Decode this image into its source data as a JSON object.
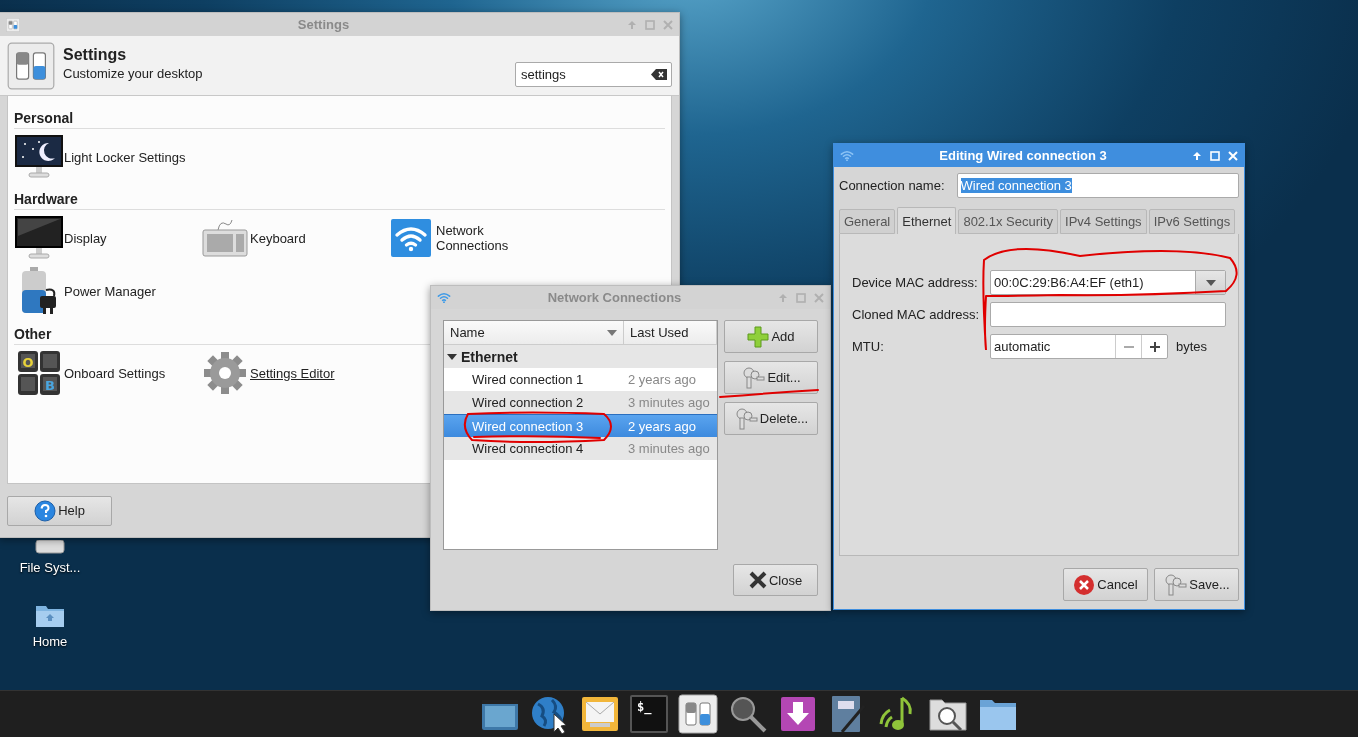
{
  "desktop_icons": [
    {
      "label": "File Syst...",
      "kind": "drive"
    },
    {
      "label": "Home",
      "kind": "folder"
    }
  ],
  "settings_window": {
    "title": "Settings",
    "header_title": "Settings",
    "header_subtitle": "Customize your desktop",
    "search": {
      "value": "settings"
    },
    "sections": [
      {
        "title": "Personal",
        "items": [
          {
            "label": "Light Locker Settings",
            "kind": "lock",
            "hovered": false
          }
        ]
      },
      {
        "title": "Hardware",
        "items": [
          {
            "label": "Display",
            "kind": "display",
            "hovered": false
          },
          {
            "label": "Keyboard",
            "kind": "keyboard",
            "hovered": false
          },
          {
            "label": "Network Connections",
            "kind": "network",
            "hovered": false
          },
          {
            "label": "Power Manager",
            "kind": "power",
            "hovered": false
          }
        ]
      },
      {
        "title": "Other",
        "items": [
          {
            "label": "Onboard Settings",
            "kind": "onboard",
            "glyphs": [
              "O",
              "B"
            ],
            "hovered": false
          },
          {
            "label": "Settings Editor",
            "kind": "editor",
            "hovered": true
          }
        ]
      }
    ],
    "help_button": "Help"
  },
  "network_window": {
    "title": "Network Connections",
    "columns": [
      "Name",
      "Last Used"
    ],
    "groups": [
      {
        "name": "Ethernet",
        "expanded": true,
        "rows": [
          {
            "name": "Wired connection 1",
            "last_used": "2 years ago",
            "selected": false
          },
          {
            "name": "Wired connection 2",
            "last_used": "3 minutes ago",
            "selected": false
          },
          {
            "name": "Wired connection 3",
            "last_used": "2 years ago",
            "selected": true
          },
          {
            "name": "Wired connection 4",
            "last_used": "3 minutes ago",
            "selected": false
          }
        ]
      }
    ],
    "buttons": [
      {
        "label": "Add",
        "kind": "add"
      },
      {
        "label": "Edit...",
        "kind": "edit"
      },
      {
        "label": "Delete...",
        "kind": "delete"
      }
    ],
    "close_button": "Close"
  },
  "edit_window": {
    "title": "Editing Wired connection 3",
    "connection_name": {
      "label": "Connection name:",
      "value": "Wired connection 3",
      "text_selected": true
    },
    "tabs": [
      {
        "label": "General",
        "selected": false
      },
      {
        "label": "Ethernet",
        "selected": true
      },
      {
        "label": "802.1x Security",
        "selected": false
      },
      {
        "label": "IPv4 Settings",
        "selected": false
      },
      {
        "label": "IPv6 Settings",
        "selected": false
      }
    ],
    "fields": [
      {
        "kind": "dropdown",
        "label": "Device MAC address:",
        "value": "00:0C:29:B6:A4:EF (eth1)"
      },
      {
        "kind": "text",
        "label": "Cloned MAC address:"
      },
      {
        "kind": "spin",
        "label": "MTU:",
        "value": "automatic",
        "unit": "bytes"
      }
    ],
    "buttons": [
      {
        "label": "Cancel",
        "kind": "cancel"
      },
      {
        "label": "Save...",
        "kind": "save"
      }
    ]
  },
  "taskbar": [
    {
      "kind": "window"
    },
    {
      "kind": "browser"
    },
    {
      "kind": "mail"
    },
    {
      "kind": "terminal",
      "glyph": "$_"
    },
    {
      "kind": "settings"
    },
    {
      "kind": "finder"
    },
    {
      "kind": "download"
    },
    {
      "kind": "notes"
    },
    {
      "kind": "music"
    },
    {
      "kind": "file-search"
    },
    {
      "kind": "files"
    }
  ]
}
